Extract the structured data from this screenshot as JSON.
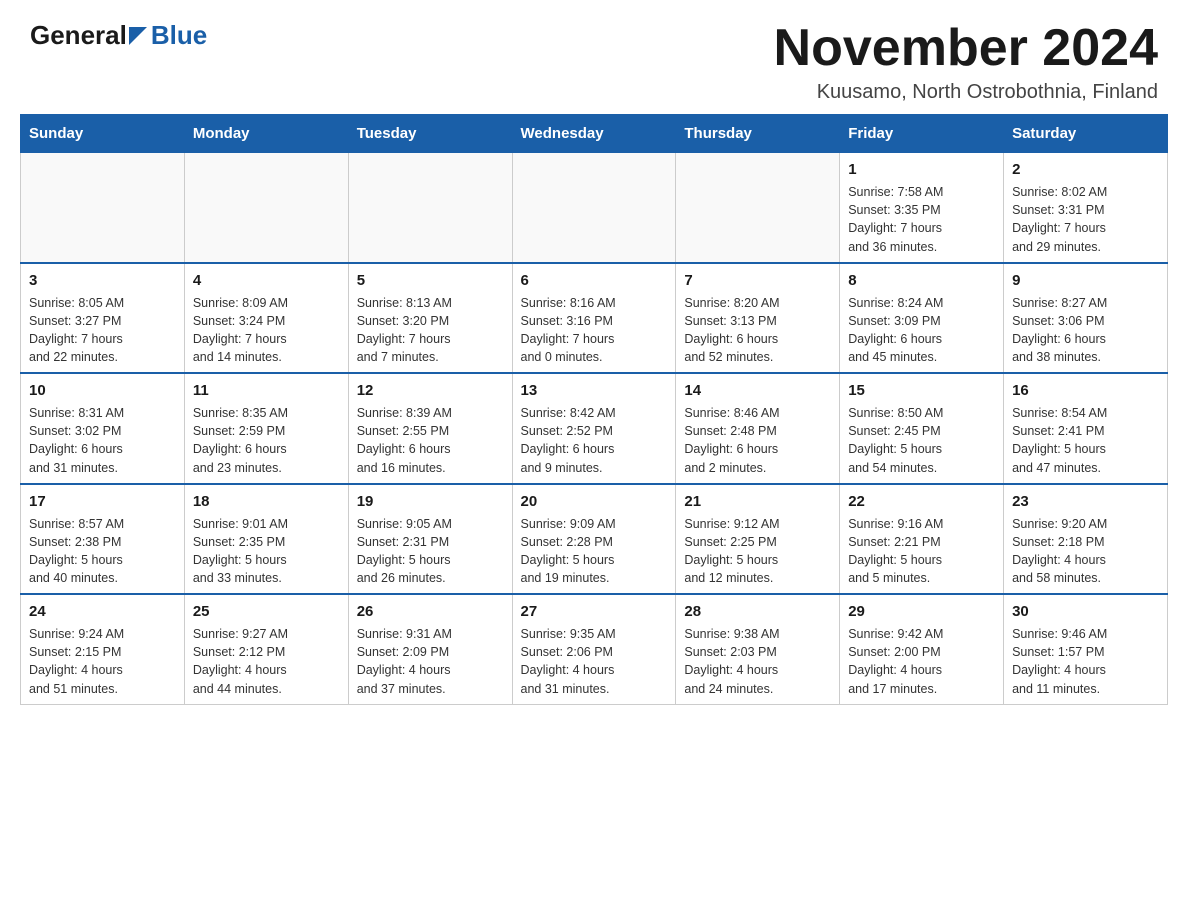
{
  "header": {
    "logo_general": "General",
    "logo_blue": "Blue",
    "month_title": "November 2024",
    "subtitle": "Kuusamo, North Ostrobothnia, Finland"
  },
  "weekdays": [
    "Sunday",
    "Monday",
    "Tuesday",
    "Wednesday",
    "Thursday",
    "Friday",
    "Saturday"
  ],
  "weeks": [
    [
      {
        "day": "",
        "info": ""
      },
      {
        "day": "",
        "info": ""
      },
      {
        "day": "",
        "info": ""
      },
      {
        "day": "",
        "info": ""
      },
      {
        "day": "",
        "info": ""
      },
      {
        "day": "1",
        "info": "Sunrise: 7:58 AM\nSunset: 3:35 PM\nDaylight: 7 hours\nand 36 minutes."
      },
      {
        "day": "2",
        "info": "Sunrise: 8:02 AM\nSunset: 3:31 PM\nDaylight: 7 hours\nand 29 minutes."
      }
    ],
    [
      {
        "day": "3",
        "info": "Sunrise: 8:05 AM\nSunset: 3:27 PM\nDaylight: 7 hours\nand 22 minutes."
      },
      {
        "day": "4",
        "info": "Sunrise: 8:09 AM\nSunset: 3:24 PM\nDaylight: 7 hours\nand 14 minutes."
      },
      {
        "day": "5",
        "info": "Sunrise: 8:13 AM\nSunset: 3:20 PM\nDaylight: 7 hours\nand 7 minutes."
      },
      {
        "day": "6",
        "info": "Sunrise: 8:16 AM\nSunset: 3:16 PM\nDaylight: 7 hours\nand 0 minutes."
      },
      {
        "day": "7",
        "info": "Sunrise: 8:20 AM\nSunset: 3:13 PM\nDaylight: 6 hours\nand 52 minutes."
      },
      {
        "day": "8",
        "info": "Sunrise: 8:24 AM\nSunset: 3:09 PM\nDaylight: 6 hours\nand 45 minutes."
      },
      {
        "day": "9",
        "info": "Sunrise: 8:27 AM\nSunset: 3:06 PM\nDaylight: 6 hours\nand 38 minutes."
      }
    ],
    [
      {
        "day": "10",
        "info": "Sunrise: 8:31 AM\nSunset: 3:02 PM\nDaylight: 6 hours\nand 31 minutes."
      },
      {
        "day": "11",
        "info": "Sunrise: 8:35 AM\nSunset: 2:59 PM\nDaylight: 6 hours\nand 23 minutes."
      },
      {
        "day": "12",
        "info": "Sunrise: 8:39 AM\nSunset: 2:55 PM\nDaylight: 6 hours\nand 16 minutes."
      },
      {
        "day": "13",
        "info": "Sunrise: 8:42 AM\nSunset: 2:52 PM\nDaylight: 6 hours\nand 9 minutes."
      },
      {
        "day": "14",
        "info": "Sunrise: 8:46 AM\nSunset: 2:48 PM\nDaylight: 6 hours\nand 2 minutes."
      },
      {
        "day": "15",
        "info": "Sunrise: 8:50 AM\nSunset: 2:45 PM\nDaylight: 5 hours\nand 54 minutes."
      },
      {
        "day": "16",
        "info": "Sunrise: 8:54 AM\nSunset: 2:41 PM\nDaylight: 5 hours\nand 47 minutes."
      }
    ],
    [
      {
        "day": "17",
        "info": "Sunrise: 8:57 AM\nSunset: 2:38 PM\nDaylight: 5 hours\nand 40 minutes."
      },
      {
        "day": "18",
        "info": "Sunrise: 9:01 AM\nSunset: 2:35 PM\nDaylight: 5 hours\nand 33 minutes."
      },
      {
        "day": "19",
        "info": "Sunrise: 9:05 AM\nSunset: 2:31 PM\nDaylight: 5 hours\nand 26 minutes."
      },
      {
        "day": "20",
        "info": "Sunrise: 9:09 AM\nSunset: 2:28 PM\nDaylight: 5 hours\nand 19 minutes."
      },
      {
        "day": "21",
        "info": "Sunrise: 9:12 AM\nSunset: 2:25 PM\nDaylight: 5 hours\nand 12 minutes."
      },
      {
        "day": "22",
        "info": "Sunrise: 9:16 AM\nSunset: 2:21 PM\nDaylight: 5 hours\nand 5 minutes."
      },
      {
        "day": "23",
        "info": "Sunrise: 9:20 AM\nSunset: 2:18 PM\nDaylight: 4 hours\nand 58 minutes."
      }
    ],
    [
      {
        "day": "24",
        "info": "Sunrise: 9:24 AM\nSunset: 2:15 PM\nDaylight: 4 hours\nand 51 minutes."
      },
      {
        "day": "25",
        "info": "Sunrise: 9:27 AM\nSunset: 2:12 PM\nDaylight: 4 hours\nand 44 minutes."
      },
      {
        "day": "26",
        "info": "Sunrise: 9:31 AM\nSunset: 2:09 PM\nDaylight: 4 hours\nand 37 minutes."
      },
      {
        "day": "27",
        "info": "Sunrise: 9:35 AM\nSunset: 2:06 PM\nDaylight: 4 hours\nand 31 minutes."
      },
      {
        "day": "28",
        "info": "Sunrise: 9:38 AM\nSunset: 2:03 PM\nDaylight: 4 hours\nand 24 minutes."
      },
      {
        "day": "29",
        "info": "Sunrise: 9:42 AM\nSunset: 2:00 PM\nDaylight: 4 hours\nand 17 minutes."
      },
      {
        "day": "30",
        "info": "Sunrise: 9:46 AM\nSunset: 1:57 PM\nDaylight: 4 hours\nand 11 minutes."
      }
    ]
  ]
}
